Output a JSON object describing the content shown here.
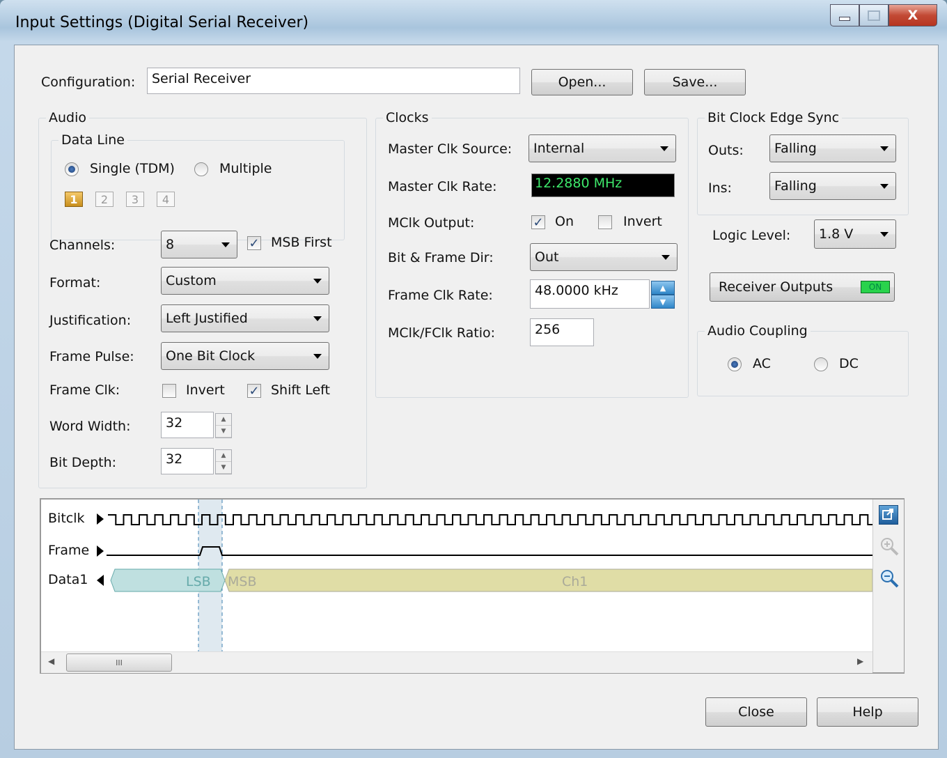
{
  "window": {
    "title": "Input Settings (Digital Serial Receiver)",
    "controls": {
      "minimize": "–",
      "maximize": "□",
      "close": "X"
    }
  },
  "config": {
    "label": "Configuration:",
    "value": "Serial Receiver",
    "open": "Open...",
    "save": "Save..."
  },
  "audio": {
    "title": "Audio",
    "data_line": {
      "title": "Data Line",
      "single": "Single (TDM)",
      "multiple": "Multiple",
      "selected": "single",
      "lines": [
        "1",
        "2",
        "3",
        "4"
      ]
    },
    "channels": {
      "label": "Channels:",
      "value": "8"
    },
    "msb_first": {
      "label": "MSB First",
      "checked": true
    },
    "format": {
      "label": "Format:",
      "value": "Custom"
    },
    "justification": {
      "label": "Justification:",
      "value": "Left Justified"
    },
    "frame_pulse": {
      "label": "Frame Pulse:",
      "value": "One Bit Clock"
    },
    "frame_clk": {
      "label": "Frame Clk:",
      "invert": "Invert",
      "invert_checked": false,
      "shift_left": "Shift Left",
      "shift_left_checked": true
    },
    "word_width": {
      "label": "Word Width:",
      "value": "32"
    },
    "bit_depth": {
      "label": "Bit Depth:",
      "value": "32"
    }
  },
  "clocks": {
    "title": "Clocks",
    "master_source": {
      "label": "Master Clk Source:",
      "value": "Internal"
    },
    "master_rate": {
      "label": "Master Clk Rate:",
      "value": "12.2880 MHz"
    },
    "mclk_output": {
      "label": "MClk Output:",
      "on": "On",
      "on_checked": true,
      "invert": "Invert",
      "invert_checked": false
    },
    "bit_frame_dir": {
      "label": "Bit & Frame Dir:",
      "value": "Out"
    },
    "frame_rate": {
      "label": "Frame Clk Rate:",
      "value": "48.0000 kHz"
    },
    "ratio": {
      "label": "MClk/FClk Ratio:",
      "value": "256"
    }
  },
  "edge_sync": {
    "title": "Bit Clock Edge Sync",
    "outs": {
      "label": "Outs:",
      "value": "Falling"
    },
    "ins": {
      "label": "Ins:",
      "value": "Falling"
    }
  },
  "logic_level": {
    "label": "Logic Level:",
    "value": "1.8 V"
  },
  "receiver_outputs": {
    "label": "Receiver Outputs",
    "state": "ON"
  },
  "coupling": {
    "title": "Audio Coupling",
    "ac": "AC",
    "dc": "DC",
    "selected": "ac"
  },
  "timing": {
    "signals": [
      "Bitclk",
      "Frame",
      "Data1"
    ],
    "lsb": "LSB",
    "msb": "MSB",
    "channel": "Ch1",
    "scroll_grip": "III"
  },
  "buttons": {
    "close": "Close",
    "help": "Help"
  },
  "colors": {
    "lcd_text": "#3ee86b",
    "led_on": "#29d34c",
    "lsb_fill": "#bfe0e0",
    "msb_fill": "#e0dda6"
  }
}
